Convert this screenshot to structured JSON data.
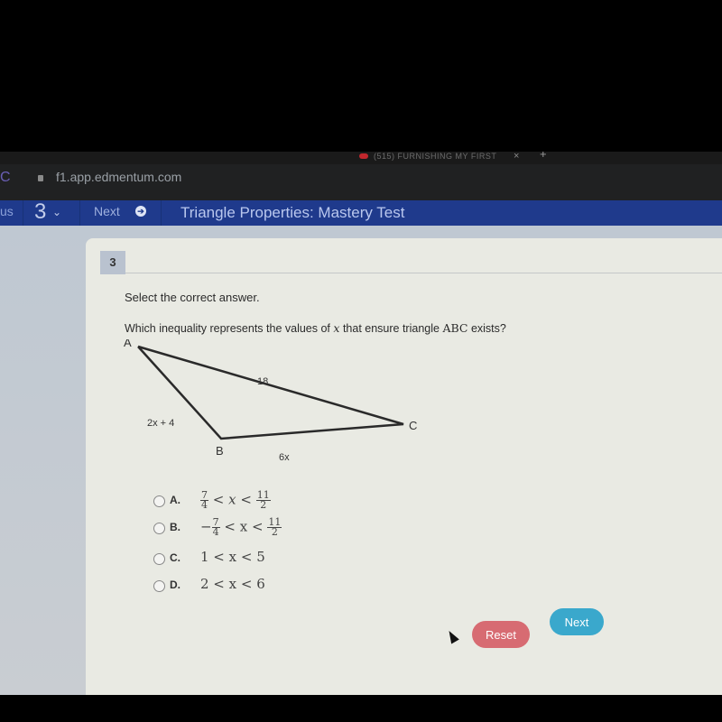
{
  "browser": {
    "tab_title": "(515) FURNISHING MY FIRST",
    "tab_close": "×",
    "new_tab": "+",
    "url": "f1.app.edmentum.com",
    "reload_icon": "C"
  },
  "navbar": {
    "prev_label": "us",
    "question_number": "3",
    "chevron": "⌄",
    "next_label": "Next",
    "next_icon": "➔",
    "title": "Triangle Properties: Mastery Test"
  },
  "question": {
    "number": "3",
    "instruction": "Select the correct answer.",
    "prompt_before": "Which inequality represents the values of",
    "variable": "x",
    "prompt_after": "that ensure triangle",
    "triangle_name": "ABC",
    "prompt_end": "exists?",
    "diagram": {
      "vertices": [
        "A",
        "B",
        "C"
      ],
      "side_AC": "18",
      "side_AB": "2x + 4",
      "side_BC": "6x"
    },
    "options": [
      {
        "letter": "A.",
        "left_num": "7",
        "left_den": "4",
        "left_sign": "",
        "var": "x",
        "right_num": "11",
        "right_den": "2"
      },
      {
        "letter": "B.",
        "left_num": "7",
        "left_den": "4",
        "left_sign": "−",
        "var": "x",
        "right_num": "11",
        "right_den": "2"
      },
      {
        "letter": "C.",
        "expr": "1 < x < 5"
      },
      {
        "letter": "D.",
        "expr": "2 < x < 6"
      }
    ],
    "lt": "<"
  },
  "buttons": {
    "reset": "Reset",
    "next": "Next"
  },
  "colors": {
    "navbar": "#1f3a8c",
    "reset": "#d76b72",
    "next": "#3aa8cc"
  }
}
